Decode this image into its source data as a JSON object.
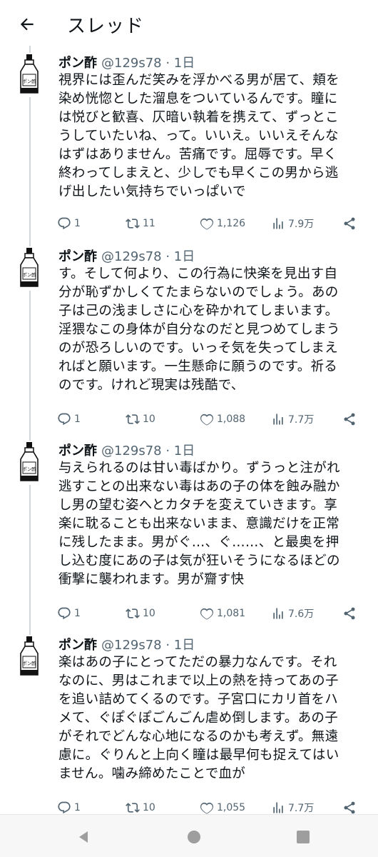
{
  "header": {
    "title": "スレッド"
  },
  "tweets": [
    {
      "name": "ポン酢",
      "meta": "@129s78 · 1日",
      "lines": [
        "視界には歪んだ笑みを浮かべる男が居て、頬を",
        "染め恍惚とした溜息をついているんです。瞳に",
        "は悦びと歓喜、仄暗い執着を携えて、ずっとこ",
        "うしていたいね、って。いいえ。いいえそんな",
        "はずはありません。苦痛です。屈辱です。早く",
        "終わってしまえと、少しでも早くこの男から逃",
        "げ出したい気持ちでいっぱいで"
      ],
      "replies": "1",
      "retweets": "11",
      "likes": "1,126",
      "views": "7.9万"
    },
    {
      "name": "ポン酢",
      "meta": "@129s78 · 1日",
      "lines": [
        "す。そして何より、この行為に快楽を見出す自",
        "分が恥ずかしくてたまらないのでしょう。あの",
        "子は己の浅ましさに心を砕かれてしまいます。",
        "淫猥なこの身体が自分なのだと見つめてしまう",
        "のが恐ろしいのです。いっそ気を失ってしまえ",
        "ればと願います。一生懸命に願うのです。祈る",
        "のです。けれど現実は残酷で、"
      ],
      "replies": "1",
      "retweets": "10",
      "likes": "1,088",
      "views": "7.7万"
    },
    {
      "name": "ポン酢",
      "meta": "@129s78 · 1日",
      "lines": [
        "与えられるのは甘い毒ばかり。ずうっと注がれ",
        "逃すことの出来ない毒はあの子の体を蝕み融か",
        "し男の望む姿へとカタチを変えていきます。享",
        "楽に耽ることも出来ないまま、意識だけを正常",
        "に残したまま。男がぐ…、ぐ……、と最奥を押",
        "し込む度にあの子は気が狂いそうになるほどの",
        "衝撃に襲われます。男が齎す快"
      ],
      "replies": "1",
      "retweets": "10",
      "likes": "1,081",
      "views": "7.6万"
    },
    {
      "name": "ポン酢",
      "meta": "@129s78 · 1日",
      "lines": [
        "楽はあの子にとってただの暴力なんです。それ",
        "なのに、男はこれまで以上の熱を持ってあの子",
        "を追い詰めてくるのです。子宮口にカリ首をハ",
        "メて、ぐぽぐぽごんごん虐め倒します。あの子",
        "がそれでどんな心地になるのかも考えず。無遠",
        "慮に。ぐりんと上向く瞳は最早何も捉えてはい",
        "ません。噛み締めたことで血が"
      ],
      "replies": "1",
      "retweets": "10",
      "likes": "1,055",
      "views": "7.7万"
    }
  ],
  "avatar_label": "ポン酢",
  "colors": {
    "text": "#0f1419",
    "secondary": "#536471",
    "thread_line": "#cfd9de"
  },
  "icons": {
    "back": "arrow-left-icon",
    "reply": "reply-icon",
    "retweet": "retweet-icon",
    "like": "heart-icon",
    "views": "views-icon",
    "share": "share-icon"
  },
  "navbar": {
    "buttons": [
      "back",
      "home",
      "recents"
    ]
  }
}
